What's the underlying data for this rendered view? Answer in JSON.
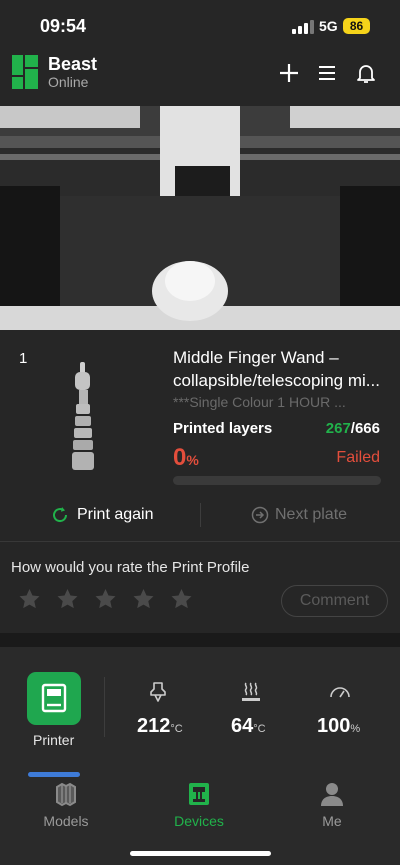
{
  "status_bar": {
    "time": "09:54",
    "network": "5G",
    "battery": "86"
  },
  "header": {
    "printer_name": "Beast",
    "printer_status": "Online"
  },
  "job": {
    "plate_index": "1",
    "title": "Middle Finger Wand – collapsible/telescoping mi...",
    "subtitle": "***Single Colour 1 HOUR ...",
    "layers_label": "Printed layers",
    "layers_current": "267",
    "layers_total": "/666",
    "progress_value": "0",
    "progress_unit": "%",
    "state": "Failed",
    "progress_fraction": 0
  },
  "actions": {
    "print_again": "Print again",
    "next_plate": "Next plate"
  },
  "rating": {
    "prompt": "How would you rate the Print Profile",
    "stars": 0,
    "max_stars": 5,
    "comment_label": "Comment"
  },
  "printer_panel": {
    "tile_label": "Printer",
    "nozzle_temp": "212",
    "nozzle_unit": "°C",
    "bed_temp": "64",
    "bed_unit": "°C",
    "speed": "100",
    "speed_unit": "%"
  },
  "tabs": [
    {
      "label": "Models",
      "icon": "models-icon",
      "active": false
    },
    {
      "label": "Devices",
      "icon": "devices-icon",
      "active": true
    },
    {
      "label": "Me",
      "icon": "person-icon",
      "active": false
    }
  ],
  "colors": {
    "accent": "#21b24b",
    "error": "#e34e3c",
    "battery": "#f5d31a",
    "background": "#262626"
  }
}
